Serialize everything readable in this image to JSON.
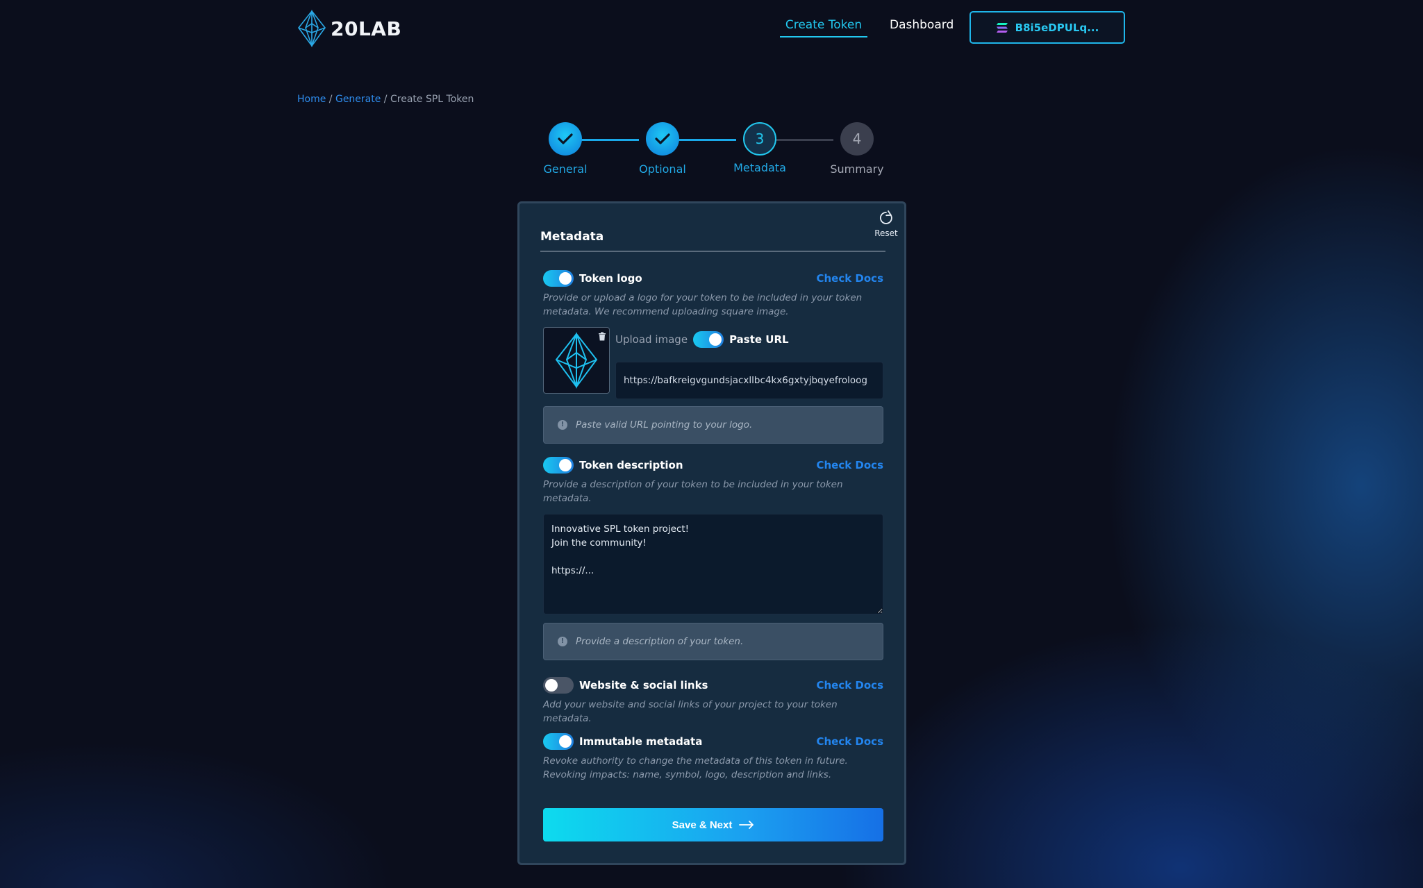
{
  "header": {
    "brand": "20LAB",
    "nav": {
      "create_token": "Create Token",
      "dashboard": "Dashboard"
    },
    "wallet": {
      "address": "B8i5eDPULq..."
    }
  },
  "breadcrumb": {
    "home": "Home",
    "generate": "Generate",
    "current": "Create SPL Token",
    "separator": " / "
  },
  "stepper": {
    "steps": [
      {
        "label": "General",
        "state": "done"
      },
      {
        "label": "Optional",
        "state": "done"
      },
      {
        "label": "Metadata",
        "number": "3",
        "state": "current"
      },
      {
        "label": "Summary",
        "number": "4",
        "state": "todo"
      }
    ]
  },
  "card": {
    "title": "Metadata",
    "reset_label": "Reset",
    "logo_section": {
      "title": "Token logo",
      "docs": "Check Docs",
      "enabled": true,
      "description": "Provide or upload a logo for your token to be included in your token metadata. We recommend uploading square image.",
      "upload_label": "Upload image",
      "paste_label": "Paste URL",
      "paste_enabled": true,
      "url_value": "https://bafkreigvgundsjacxllbc4kx6gxtyjbqyefroloog",
      "hint": "Paste valid URL pointing to your logo."
    },
    "description_section": {
      "title": "Token description",
      "docs": "Check Docs",
      "enabled": true,
      "description": "Provide a description of your token to be included in your token metadata.",
      "value": "Innovative SPL token project!\nJoin the community!\n\nhttps://...",
      "hint": "Provide a description of your token."
    },
    "links_section": {
      "title": "Website & social links",
      "docs": "Check Docs",
      "enabled": false,
      "description": "Add your website and social links of your project to your token metadata."
    },
    "immutable_section": {
      "title": "Immutable metadata",
      "docs": "Check Docs",
      "enabled": true,
      "description": "Revoke authority to change the metadata of this token in future. Revoking impacts: name, symbol, logo, description and links."
    },
    "save_label": "Save & Next"
  },
  "colors": {
    "accent": "#22c7ee",
    "link": "#2385ee",
    "card_bg": "#162c40",
    "page_bg": "#0b0e1c"
  }
}
